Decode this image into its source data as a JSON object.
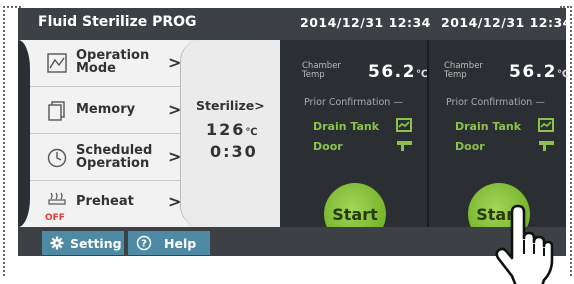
{
  "header": {
    "title": "Fluid Sterilize PROG",
    "datetime_left": "2014/12/31 12:34",
    "datetime_right": "2014/12/31 12:34"
  },
  "menu": {
    "items": [
      {
        "label_line1": "Operation",
        "label_line2": "Mode",
        "icon": "operation-mode-icon"
      },
      {
        "label_line1": "Memory",
        "label_line2": "",
        "icon": "memory-icon"
      },
      {
        "label_line1": "Scheduled",
        "label_line2": "Operation",
        "icon": "clock-icon"
      },
      {
        "label_line1": "Preheat",
        "label_line2": "",
        "icon": "preheat-icon",
        "icon_text": "OFF"
      }
    ],
    "chevron": ">"
  },
  "sterilize": {
    "label": "Sterilize",
    "arrow": ">",
    "temp": "126",
    "temp_unit": "℃",
    "time": "0:30"
  },
  "panels": [
    {
      "chamber_label_1": "Chamber",
      "chamber_label_2": "Temp",
      "chamber_value": "56.2",
      "unit": "℃",
      "prior_confirmation": "Prior Confirmation —",
      "drain_tank": "Drain Tank",
      "door": "Door",
      "start": "Start"
    },
    {
      "chamber_label_1": "Chamber",
      "chamber_label_2": "Temp",
      "chamber_value": "56.2",
      "unit": "℃",
      "prior_confirmation": "Prior Confirmation —",
      "drain_tank": "Drain Tank",
      "door": "Door",
      "start": "Start"
    }
  ],
  "footer": {
    "setting": "Setting",
    "help": "Help"
  },
  "colors": {
    "accent_green": "#8bc34a",
    "start_green": "#78b62d",
    "footer_button": "#4f8aa4",
    "dark_bg": "#2b2f33"
  }
}
